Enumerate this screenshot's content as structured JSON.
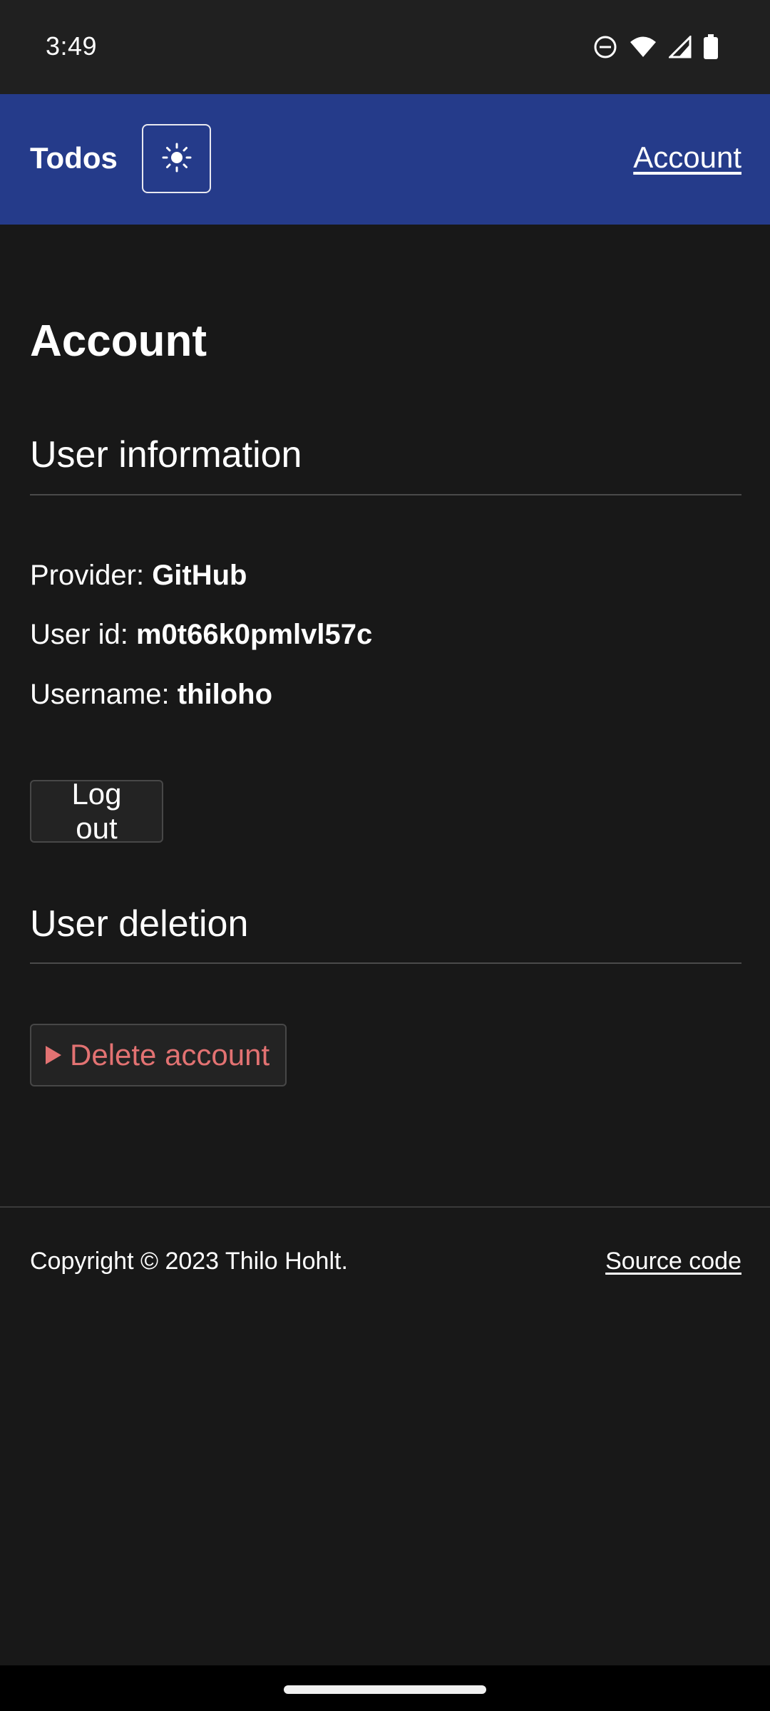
{
  "status_bar": {
    "time": "3:49",
    "icons": [
      "do-not-disturb-icon",
      "wifi-icon",
      "cellular-signal-icon",
      "battery-icon"
    ]
  },
  "header": {
    "brand": "Todos",
    "theme_toggle_icon": "sun-icon",
    "account_link": "Account",
    "background": "#253b8a"
  },
  "main": {
    "title": "Account",
    "user_information": {
      "heading": "User information",
      "provider_label": "Provider:",
      "provider_value": "GitHub",
      "user_id_label": "User id:",
      "user_id_value": "m0t66k0pmlvl57c",
      "username_label": "Username:",
      "username_value": "thiloho"
    },
    "logout_button": "Log out",
    "user_deletion": {
      "heading": "User deletion",
      "delete_summary": "Delete account",
      "delete_color": "#e27272"
    }
  },
  "footer": {
    "copyright": "Copyright © 2023 Thilo Hohlt.",
    "source_link": "Source code"
  },
  "colors": {
    "page_background": "#181818",
    "status_bar_background": "#202020"
  }
}
